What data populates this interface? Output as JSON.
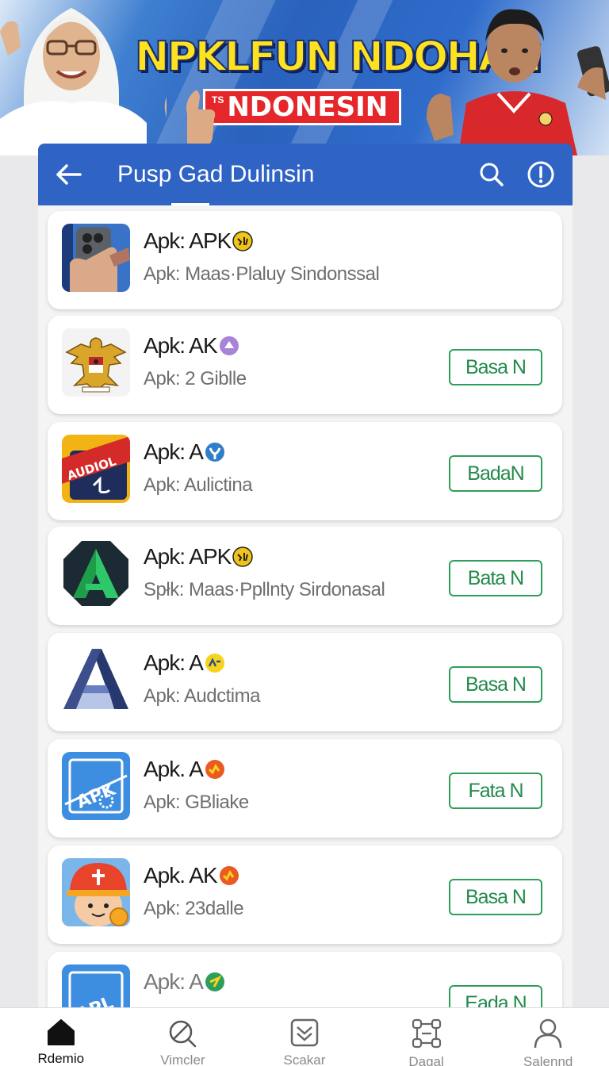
{
  "banner": {
    "title": "NPKLFUN NDOHAN",
    "subtitle_small": "TS",
    "subtitle": "NDONESIN"
  },
  "appbar": {
    "title": "Pusp Gad Dulinsin"
  },
  "apps": [
    {
      "name": "Apk: APK",
      "desc": "Apk: Maas·Plaluy Sindonssal",
      "button": ""
    },
    {
      "name": "Apk: AK",
      "desc": "Apk: 2 Giblle",
      "button": "Basa N"
    },
    {
      "name": "Apk: A",
      "desc": "Apk: Aulictina",
      "button": "BadaN"
    },
    {
      "name": "Apk: APK",
      "desc": "Spłk: Maas·Ppllnty Sirdonasal",
      "button": "Bata N"
    },
    {
      "name": "Apk: A",
      "desc": "Apk: Audctima",
      "button": "Basa N"
    },
    {
      "name": "Apk. A",
      "desc": "Apk: GBliake",
      "button": "Fata N"
    },
    {
      "name": "Apk. AK",
      "desc": "Apk: 23dalle",
      "button": "Basa N"
    },
    {
      "name": "Apk: A",
      "desc": "",
      "button": "Eada N"
    }
  ],
  "nav": [
    {
      "label": "Rdemio",
      "icon": "home-icon"
    },
    {
      "label": "Vimcler",
      "icon": "search-pen-icon"
    },
    {
      "label": "Scakar",
      "icon": "inbox-icon"
    },
    {
      "label": "Dagal",
      "icon": "nodes-icon"
    },
    {
      "label": "Salennd",
      "icon": "person-icon"
    }
  ],
  "colors": {
    "appbar": "#2f64c4",
    "accent_green": "#2e9e5b",
    "banner_title": "#ffe21f",
    "banner_red": "#e5262a"
  }
}
